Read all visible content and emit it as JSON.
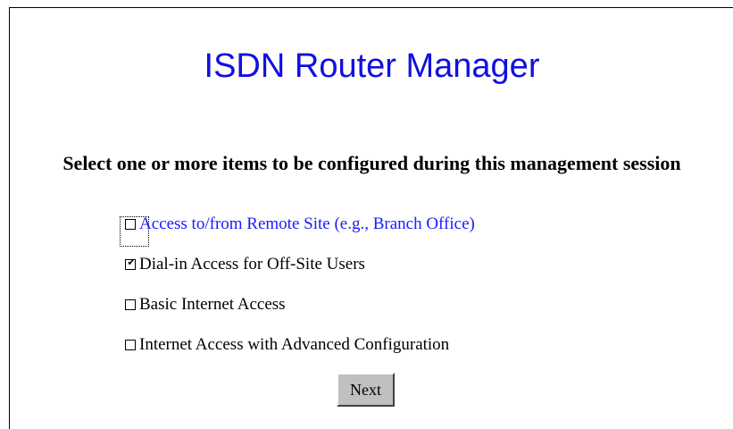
{
  "page": {
    "title": "ISDN Router Manager",
    "prompt": "Select one or more items to be configured during this management session"
  },
  "options": [
    {
      "label": "Access to/from Remote Site (e.g., Branch Office)",
      "checked": false,
      "is_link": true
    },
    {
      "label": "Dial-in Access for Off-Site Users",
      "checked": true,
      "is_link": false
    },
    {
      "label": "Basic Internet Access",
      "checked": false,
      "is_link": false
    },
    {
      "label": "Internet Access with Advanced Configuration",
      "checked": false,
      "is_link": false
    }
  ],
  "actions": {
    "next_label": "Next"
  },
  "colors": {
    "title": "#1010e0",
    "link": "#1a1aff",
    "button_face": "#c0c0c0"
  },
  "icons": {
    "checked": "check-mark-icon"
  }
}
